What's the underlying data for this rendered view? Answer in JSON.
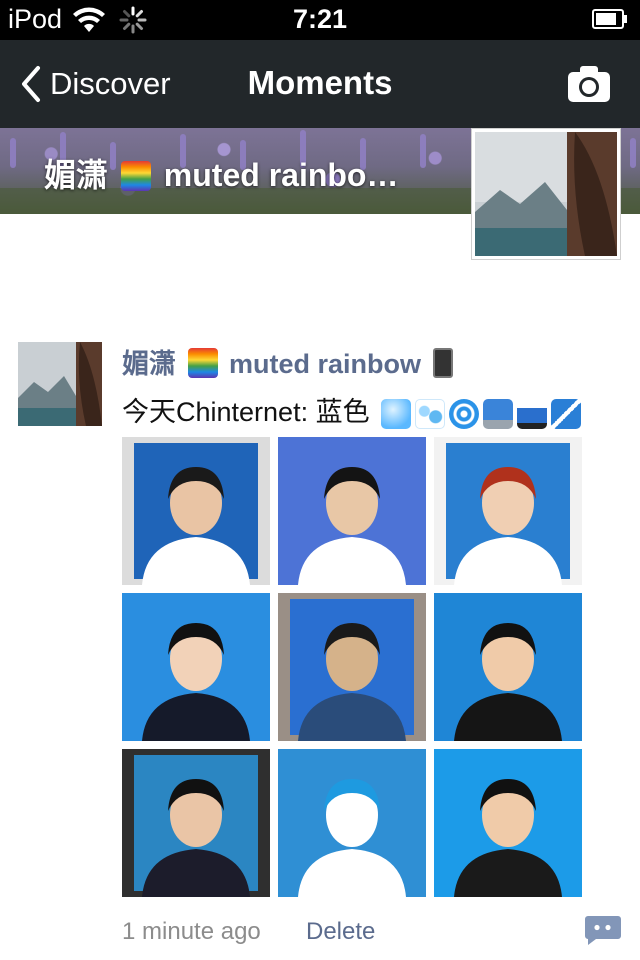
{
  "status_bar": {
    "carrier": "iPod",
    "time": "7:21"
  },
  "nav": {
    "back_label": "Discover",
    "title": "Moments",
    "camera_icon": "camera-icon"
  },
  "cover": {
    "name_prefix": "媚潇",
    "name_suffix": "muted rainbo…"
  },
  "post": {
    "author_prefix": "媚潇",
    "author_suffix": "muted rainbow",
    "text": "今天Chinternet: 蓝色",
    "emojis": [
      "gem-icon",
      "droplets-icon",
      "cyclone-icon",
      "computer-icon",
      "car-icon",
      "no-signal-icon"
    ],
    "time_ago": "1 minute ago",
    "delete_label": "Delete",
    "photos": [
      {
        "bg": "#1f64b8",
        "skin": "#e9c4a4",
        "hair": "#1a1a1a",
        "shirt": "#ffffff",
        "frame": "#dcdcdc"
      },
      {
        "bg": "#4d73d6",
        "skin": "#e8c7a6",
        "hair": "#141414",
        "shirt": "#ffffff",
        "frame": "#4d73d6"
      },
      {
        "bg": "#2a7fd0",
        "skin": "#f0cfb3",
        "hair": "#b0311c",
        "shirt": "#ffffff",
        "frame": "#f2f2f2"
      },
      {
        "bg": "#2a8ee0",
        "skin": "#f2d2b8",
        "hair": "#111111",
        "shirt": "#151a2a",
        "frame": "#2a8ee0"
      },
      {
        "bg": "#2a6fd1",
        "skin": "#d5b28a",
        "hair": "#1a1a1a",
        "shirt": "#2a4c7a",
        "frame": "#9a8f86"
      },
      {
        "bg": "#1f86d6",
        "skin": "#f0cba9",
        "hair": "#111111",
        "shirt": "#151515",
        "frame": "#1f86d6"
      },
      {
        "bg": "#2b86c2",
        "skin": "#eac5a6",
        "hair": "#111111",
        "shirt": "#1c1c2b",
        "frame": "#2f2f2f"
      },
      {
        "bg": "#2f8fd4",
        "skin": "#ffffff",
        "hair": "#1e9ae0",
        "shirt": "#ffffff",
        "frame": "#2f8fd4"
      },
      {
        "bg": "#1c9be8",
        "skin": "#f0cba9",
        "hair": "#111111",
        "shirt": "#1a1a1a",
        "frame": "#1c9be8"
      }
    ]
  },
  "colors": {
    "navbar": "#22272a",
    "link": "#5b6b8d",
    "muted": "#8c8c8c"
  }
}
